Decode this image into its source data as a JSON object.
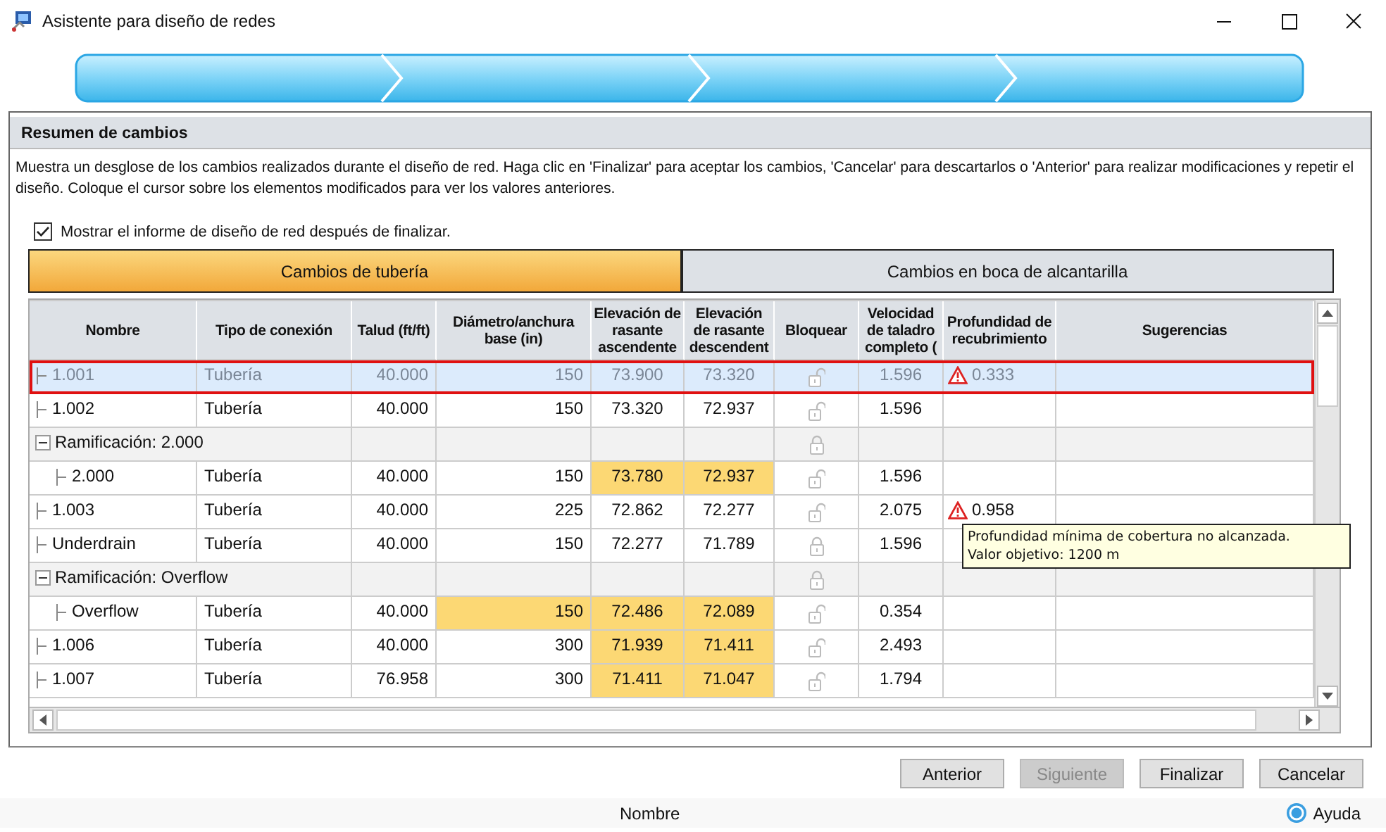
{
  "window": {
    "title": "Asistente para diseño de redes"
  },
  "wizard": {
    "level": 1
  },
  "panel": {
    "title": "Resumen de cambios",
    "description": "Muestra un desglose de los cambios realizados durante el diseño de red. Haga clic en 'Finalizar' para aceptar los cambios, 'Cancelar' para descartarlos o 'Anterior' para realizar modificaciones y repetir el diseño. Coloque el cursor sobre los elementos modificados para ver los valores anteriores.",
    "option": {
      "label": "Mostrar el informe de diseño de red después de finalizar.",
      "checked": true
    }
  },
  "tabs": [
    {
      "label": "Cambios de tubería",
      "selected": true
    },
    {
      "label": "Cambios en boca de alcantarilla",
      "selected": false
    }
  ],
  "table": {
    "columns": [
      "Nombre",
      "Tipo de conexión",
      "Talud (ft/ft)",
      "Diámetro/anchura base (in)",
      "Elevación de rasante ascendente",
      "Elevación de rasante descendent",
      "Bloquear",
      "Velocidad de taladro completo (",
      "Profundidad de recubrimiento",
      "Sugerencias"
    ],
    "rows": [
      {
        "kind": "pipe",
        "name": "1.001",
        "selected": true,
        "locked": false,
        "warning": true,
        "cover": "0.333",
        "cells": [
          {
            "text": "Tubería",
            "changed": false
          },
          {
            "text": "40.000",
            "changed": false
          },
          {
            "text": "150",
            "changed": false
          },
          {
            "text": "73.900",
            "changed": false
          },
          {
            "text": "73.320",
            "changed": false
          },
          {
            "text": "1.596",
            "changed": false
          }
        ]
      },
      {
        "kind": "pipe",
        "name": "1.002",
        "selected": false,
        "locked": false,
        "warning": false,
        "cells": [
          {
            "text": "Tubería",
            "changed": false
          },
          {
            "text": "40.000",
            "changed": false
          },
          {
            "text": "150",
            "changed": false
          },
          {
            "text": "73.320",
            "changed": false
          },
          {
            "text": "72.937",
            "changed": false
          },
          {
            "text": "1.596",
            "changed": false
          }
        ]
      },
      {
        "kind": "branch",
        "name": "Ramificación: 2.000",
        "selected": false,
        "expanded": true,
        "locked": true,
        "children": [
          {
            "kind": "pipe",
            "name": "2.000",
            "selected": false,
            "locked": false,
            "warning": false,
            "cells": [
              {
                "text": "Tubería",
                "changed": false
              },
              {
                "text": "40.000",
                "changed": false
              },
              {
                "text": "150",
                "changed": false
              },
              {
                "text": "73.780",
                "changed": true
              },
              {
                "text": "72.937",
                "changed": true
              },
              {
                "text": "1.596",
                "changed": false
              }
            ]
          }
        ]
      },
      {
        "kind": "pipe",
        "name": "1.003",
        "selected": false,
        "locked": false,
        "warning": true,
        "cover": "0.958",
        "cells": [
          {
            "text": "Tubería",
            "changed": false
          },
          {
            "text": "40.000",
            "changed": false
          },
          {
            "text": "225",
            "changed": false
          },
          {
            "text": "72.862",
            "changed": false
          },
          {
            "text": "72.277",
            "changed": false
          },
          {
            "text": "2.075",
            "changed": false
          }
        ]
      },
      {
        "kind": "pipe",
        "name": "Underdrain",
        "selected": false,
        "locked": true,
        "warning": false,
        "cells": [
          {
            "text": "Tubería",
            "changed": false
          },
          {
            "text": "40.000",
            "changed": false
          },
          {
            "text": "150",
            "changed": false
          },
          {
            "text": "72.277",
            "changed": false
          },
          {
            "text": "71.789",
            "changed": false
          },
          {
            "text": "1.596",
            "changed": false
          }
        ]
      },
      {
        "kind": "branch",
        "name": "Ramificación: Overflow",
        "selected": false,
        "expanded": true,
        "locked": true,
        "children": [
          {
            "kind": "pipe",
            "name": "Overflow",
            "selected": false,
            "locked": false,
            "warning": false,
            "cells": [
              {
                "text": "Tubería",
                "changed": false
              },
              {
                "text": "40.000",
                "changed": false
              },
              {
                "text": "150",
                "changed": true
              },
              {
                "text": "72.486",
                "changed": true
              },
              {
                "text": "72.089",
                "changed": true
              },
              {
                "text": "0.354",
                "changed": false
              }
            ]
          }
        ]
      },
      {
        "kind": "pipe",
        "name": "1.006",
        "selected": false,
        "locked": false,
        "warning": false,
        "cells": [
          {
            "text": "Tubería",
            "changed": false
          },
          {
            "text": "40.000",
            "changed": false
          },
          {
            "text": "300",
            "changed": false
          },
          {
            "text": "71.939",
            "changed": true
          },
          {
            "text": "71.411",
            "changed": true
          },
          {
            "text": "2.493",
            "changed": false
          }
        ]
      },
      {
        "kind": "pipe",
        "name": "1.007",
        "selected": false,
        "locked": false,
        "warning": false,
        "cells": [
          {
            "text": "Tubería",
            "changed": false
          },
          {
            "text": "76.958",
            "changed": false
          },
          {
            "text": "300",
            "changed": false
          },
          {
            "text": "71.411",
            "changed": true
          },
          {
            "text": "71.047",
            "changed": true
          },
          {
            "text": "1.794",
            "changed": false
          }
        ]
      }
    ]
  },
  "tooltip": {
    "lines": [
      "Profundidad mínima de cobertura no alcanzada.",
      "Valor objetivo: 1200 m"
    ]
  },
  "buttons": [
    {
      "label": "Anterior",
      "disabled": false
    },
    {
      "label": "Siguiente",
      "disabled": true
    },
    {
      "label": "Finalizar",
      "disabled": false
    },
    {
      "label": "Cancelar",
      "disabled": false
    }
  ],
  "status_bar": {
    "text": "Nombre",
    "help": "Ayuda"
  }
}
